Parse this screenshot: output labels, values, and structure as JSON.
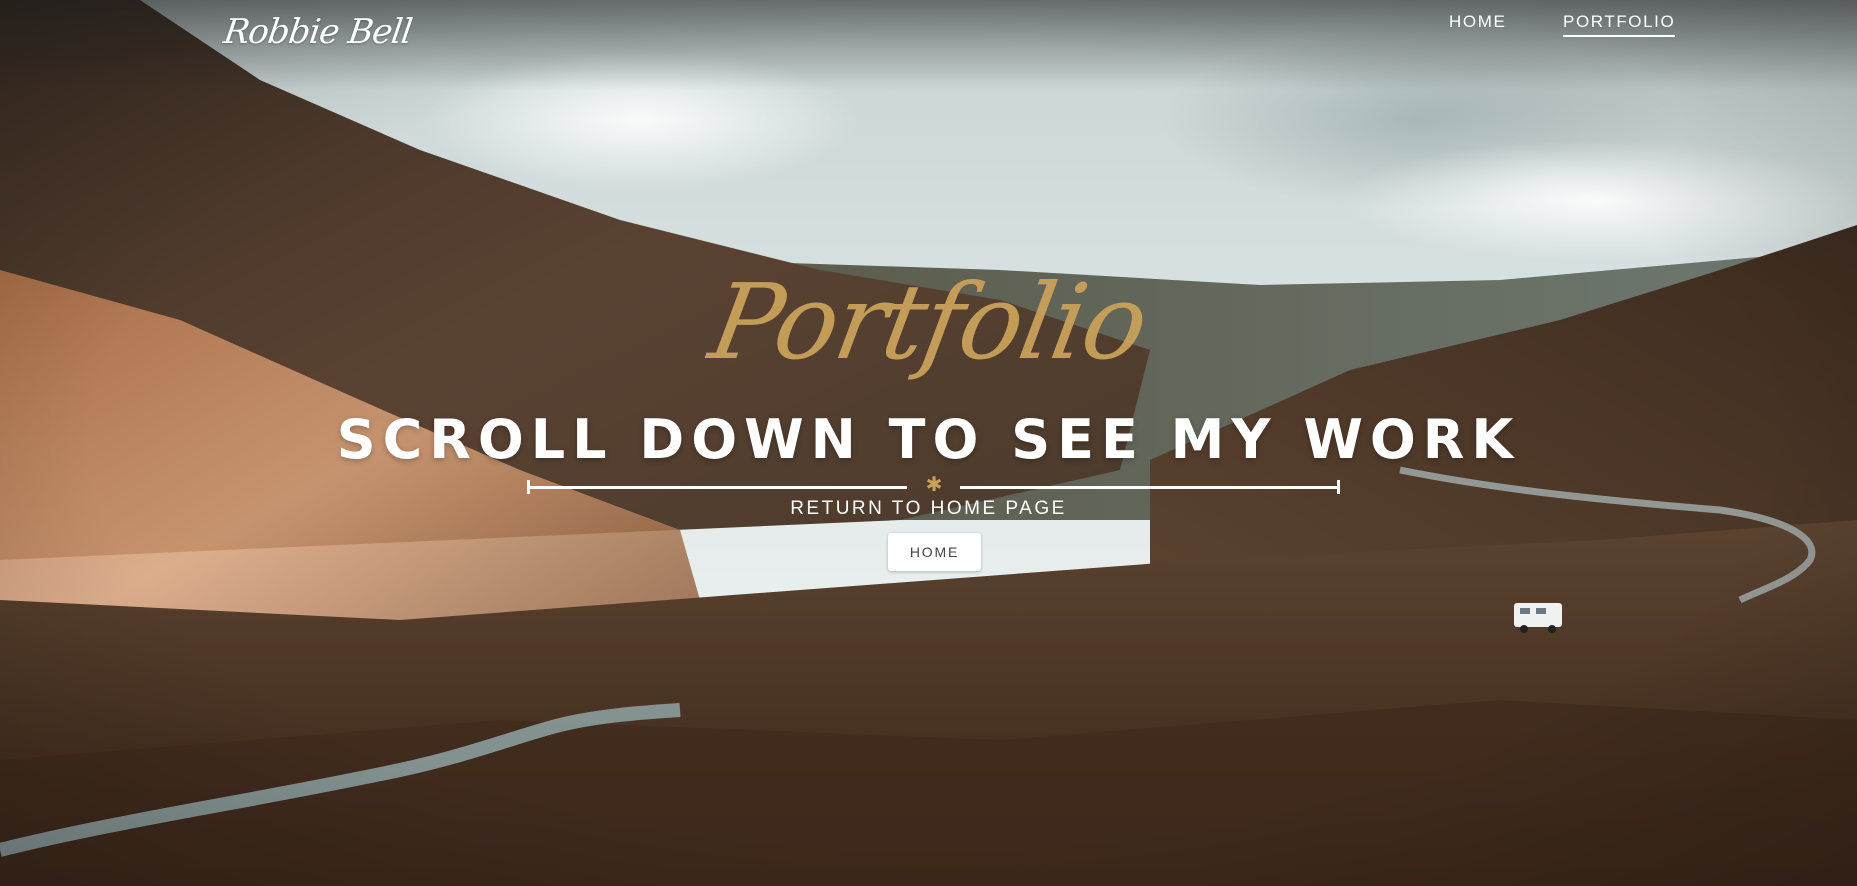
{
  "brand": {
    "logo_text": "Robbie Bell"
  },
  "nav": {
    "items": [
      {
        "label": "HOME",
        "active": false
      },
      {
        "label": "PORTFOLIO",
        "active": true
      }
    ]
  },
  "hero": {
    "script_title": "Portfolio",
    "headline": "SCROLL DOWN TO SEE MY WORK",
    "divider_icon": "asterisk-icon",
    "subline": "RETURN TO HOME PAGE",
    "button_label": "HOME"
  },
  "colors": {
    "accent_gold": "#c9a15a",
    "text_white": "#ffffff",
    "button_text": "#444444"
  }
}
